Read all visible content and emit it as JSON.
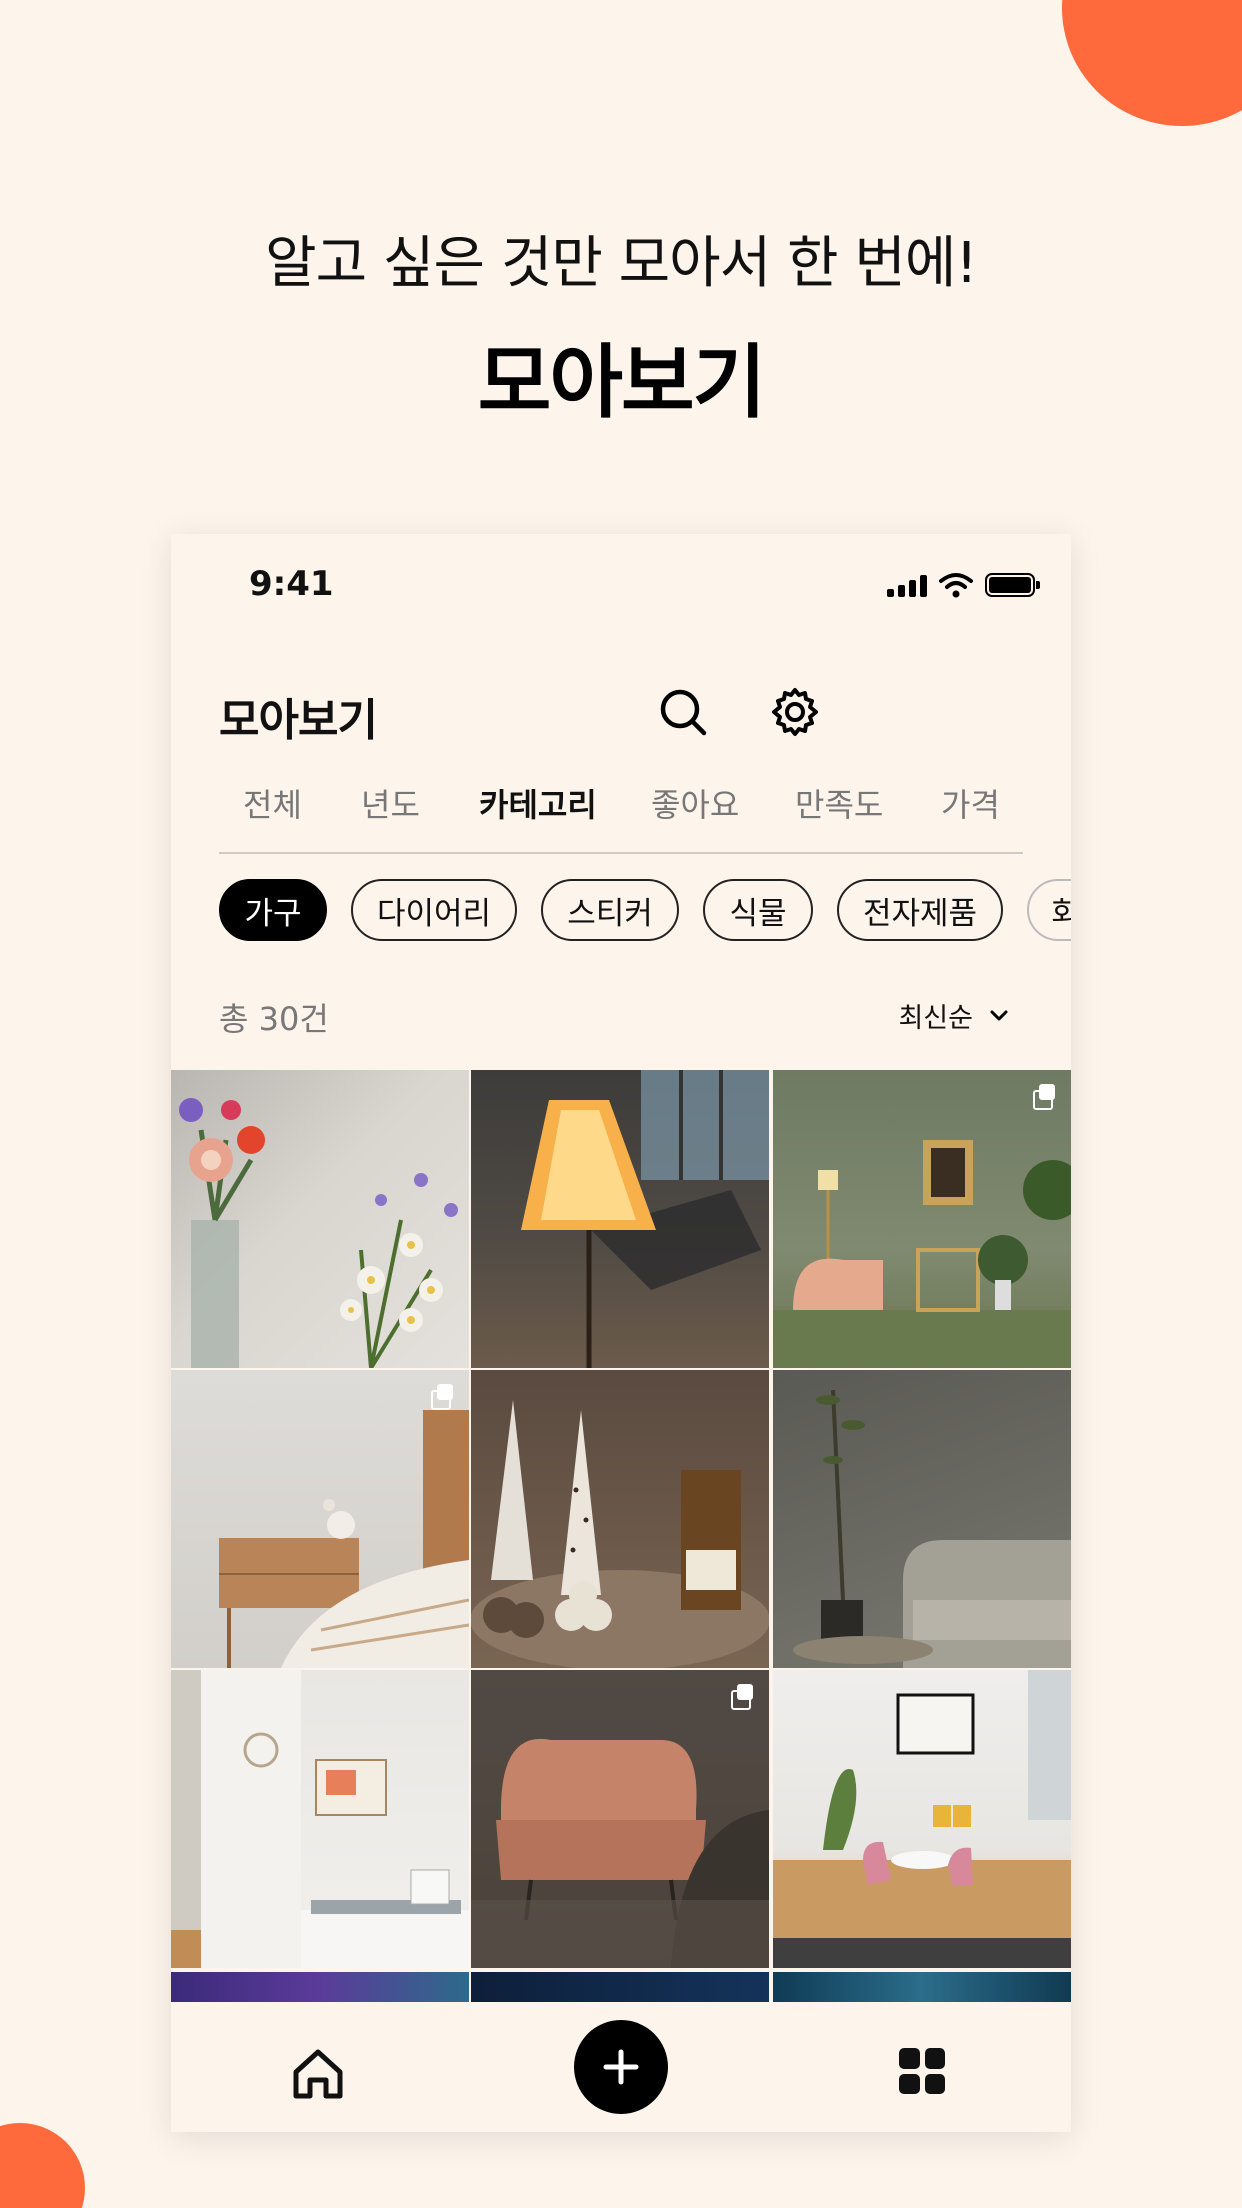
{
  "promo": {
    "subtitle": "알고 싶은 것만 모아서 한 번에!",
    "title": "모아보기"
  },
  "status_bar": {
    "time": "9:41"
  },
  "header": {
    "title": "모아보기",
    "search_icon": "search-icon",
    "settings_icon": "gear-icon"
  },
  "tabs": [
    {
      "label": "전체",
      "active": false
    },
    {
      "label": "년도",
      "active": false
    },
    {
      "label": "카테고리",
      "active": true
    },
    {
      "label": "좋아요",
      "active": false
    },
    {
      "label": "만족도",
      "active": false
    },
    {
      "label": "가격",
      "active": false
    }
  ],
  "chips": [
    {
      "label": "가구",
      "selected": true
    },
    {
      "label": "다이어리",
      "selected": false
    },
    {
      "label": "스티커",
      "selected": false
    },
    {
      "label": "식물",
      "selected": false
    },
    {
      "label": "전자제품",
      "selected": false
    },
    {
      "label": "회",
      "selected": false
    }
  ],
  "list": {
    "count": "총 30건",
    "sort": "최신순"
  },
  "photos": [
    {
      "subject": "flowers in vase",
      "multiple": false
    },
    {
      "subject": "table lamp",
      "multiple": false
    },
    {
      "subject": "green living room",
      "multiple": true
    },
    {
      "subject": "bedside table",
      "multiple": true
    },
    {
      "subject": "candles",
      "multiple": false
    },
    {
      "subject": "plant and sofa",
      "multiple": false
    },
    {
      "subject": "white room with bench",
      "multiple": false
    },
    {
      "subject": "pink lounge chair",
      "multiple": true
    },
    {
      "subject": "dining corner",
      "multiple": false
    }
  ],
  "bottom_nav": {
    "home_icon": "home-icon",
    "add_icon": "plus-icon",
    "grid_icon": "grid-icon"
  },
  "colors": {
    "background": "#fdf4ec",
    "accent": "#ff6a3d",
    "primary": "#000000"
  }
}
